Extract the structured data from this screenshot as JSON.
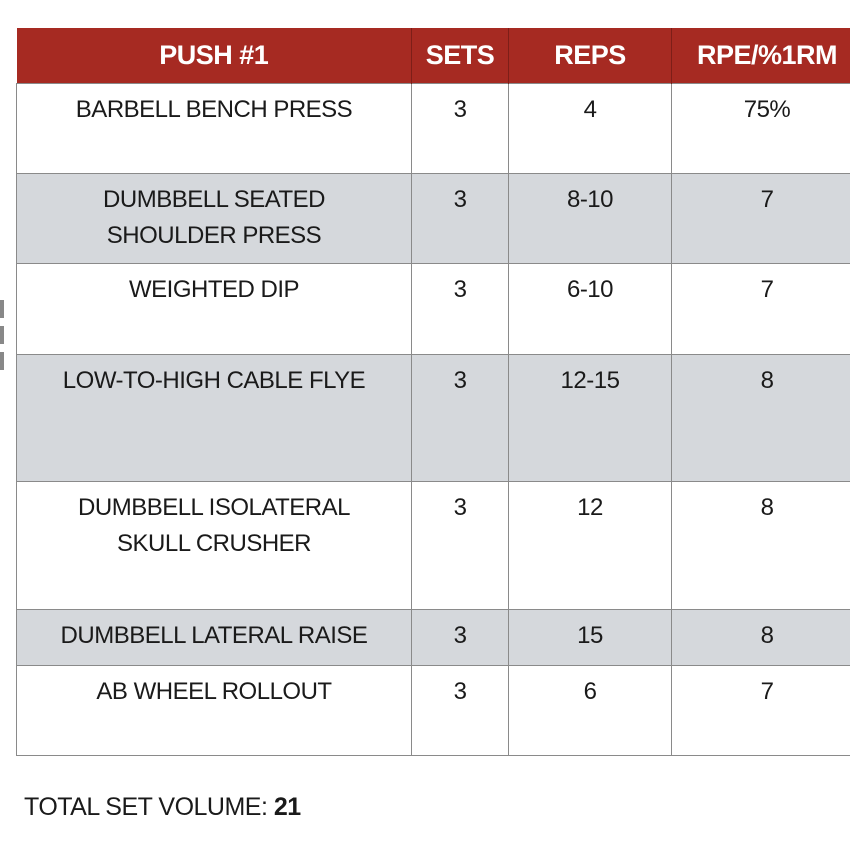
{
  "header": {
    "exercise": "PUSH #1",
    "sets": "SETS",
    "reps": "REPS",
    "intensity": "RPE/%1RM"
  },
  "rows": [
    {
      "exercise": "BARBELL BENCH PRESS",
      "sets": "3",
      "reps": "4",
      "intensity": "75%"
    },
    {
      "exercise": "DUMBBELL SEATED SHOULDER PRESS",
      "sets": "3",
      "reps": "8-10",
      "intensity": "7"
    },
    {
      "exercise": "WEIGHTED DIP",
      "sets": "3",
      "reps": "6-10",
      "intensity": "7"
    },
    {
      "exercise": "LOW-TO-HIGH CABLE FLYE",
      "sets": "3",
      "reps": "12-15",
      "intensity": "8"
    },
    {
      "exercise": "DUMBBELL ISOLATERAL SKULL CRUSHER",
      "sets": "3",
      "reps": "12",
      "intensity": "8"
    },
    {
      "exercise": "DUMBBELL LATERAL RAISE",
      "sets": "3",
      "reps": "15",
      "intensity": "8"
    },
    {
      "exercise": "AB WHEEL ROLLOUT",
      "sets": "3",
      "reps": "6",
      "intensity": "7"
    }
  ],
  "total": {
    "label": "TOTAL SET VOLUME:",
    "value": "21"
  },
  "colors": {
    "header_bg": "#a62a22",
    "shaded_row_bg": "#d5d8dc"
  }
}
